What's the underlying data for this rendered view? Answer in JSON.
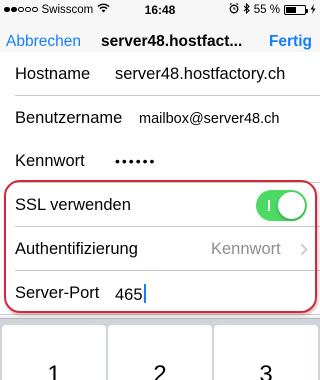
{
  "status_bar": {
    "carrier": "Swisscom",
    "time": "16:48",
    "battery_percent": "55 %",
    "battery_level": 0.55,
    "signal_bars_filled": 2,
    "signal_bars_total": 5
  },
  "nav": {
    "cancel_label": "Abbrechen",
    "title": "server48.hostfact...",
    "done_label": "Fertig"
  },
  "form": {
    "hostname": {
      "label": "Hostname",
      "value": "server48.hostfactory.ch"
    },
    "username": {
      "label": "Benutzername",
      "value": "mailbox@server48.ch"
    },
    "password": {
      "label": "Kennwort",
      "value": "••••••"
    },
    "ssl": {
      "label": "SSL verwenden",
      "enabled": true
    },
    "auth": {
      "label": "Authentifizierung",
      "value": "Kennwort"
    },
    "port": {
      "label": "Server-Port",
      "value": "465"
    }
  },
  "keyboard": {
    "keys": [
      "1",
      "2",
      "3"
    ]
  },
  "colors": {
    "accent": "#157efb",
    "toggle_on": "#4cd964",
    "annotation": "#d1283a"
  },
  "icons": [
    "wifi-icon",
    "alarm-icon",
    "bluetooth-icon",
    "charging-icon",
    "chevron-right-icon"
  ]
}
